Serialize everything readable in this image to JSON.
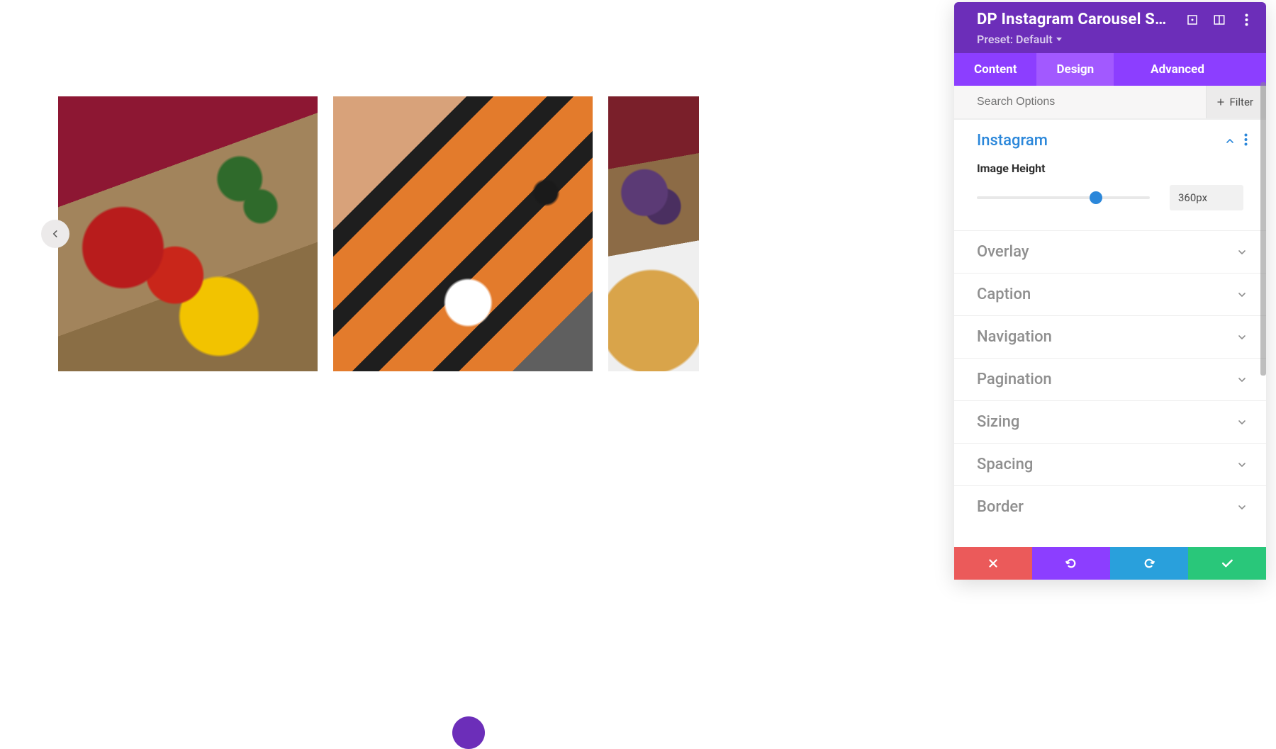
{
  "panel": {
    "title": "DP Instagram Carousel Setti...",
    "preset_label": "Preset: Default",
    "tabs": {
      "content": "Content",
      "design": "Design",
      "advanced": "Advanced"
    },
    "active_tab": "design",
    "search_placeholder": "Search Options",
    "filter_label": "Filter"
  },
  "sections": {
    "instagram": {
      "title": "Instagram",
      "open": true,
      "fields": {
        "image_height": {
          "label": "Image Height",
          "value": "360px",
          "percent": 69
        }
      }
    },
    "overlay": {
      "title": "Overlay"
    },
    "caption": {
      "title": "Caption"
    },
    "navigation": {
      "title": "Navigation"
    },
    "pagination": {
      "title": "Pagination"
    },
    "sizing": {
      "title": "Sizing"
    },
    "spacing": {
      "title": "Spacing"
    },
    "border": {
      "title": "Border"
    }
  },
  "footer": {
    "cancel": "Cancel",
    "undo": "Undo",
    "redo": "Redo",
    "save": "Save"
  },
  "carousel": {
    "prev": "‹"
  }
}
